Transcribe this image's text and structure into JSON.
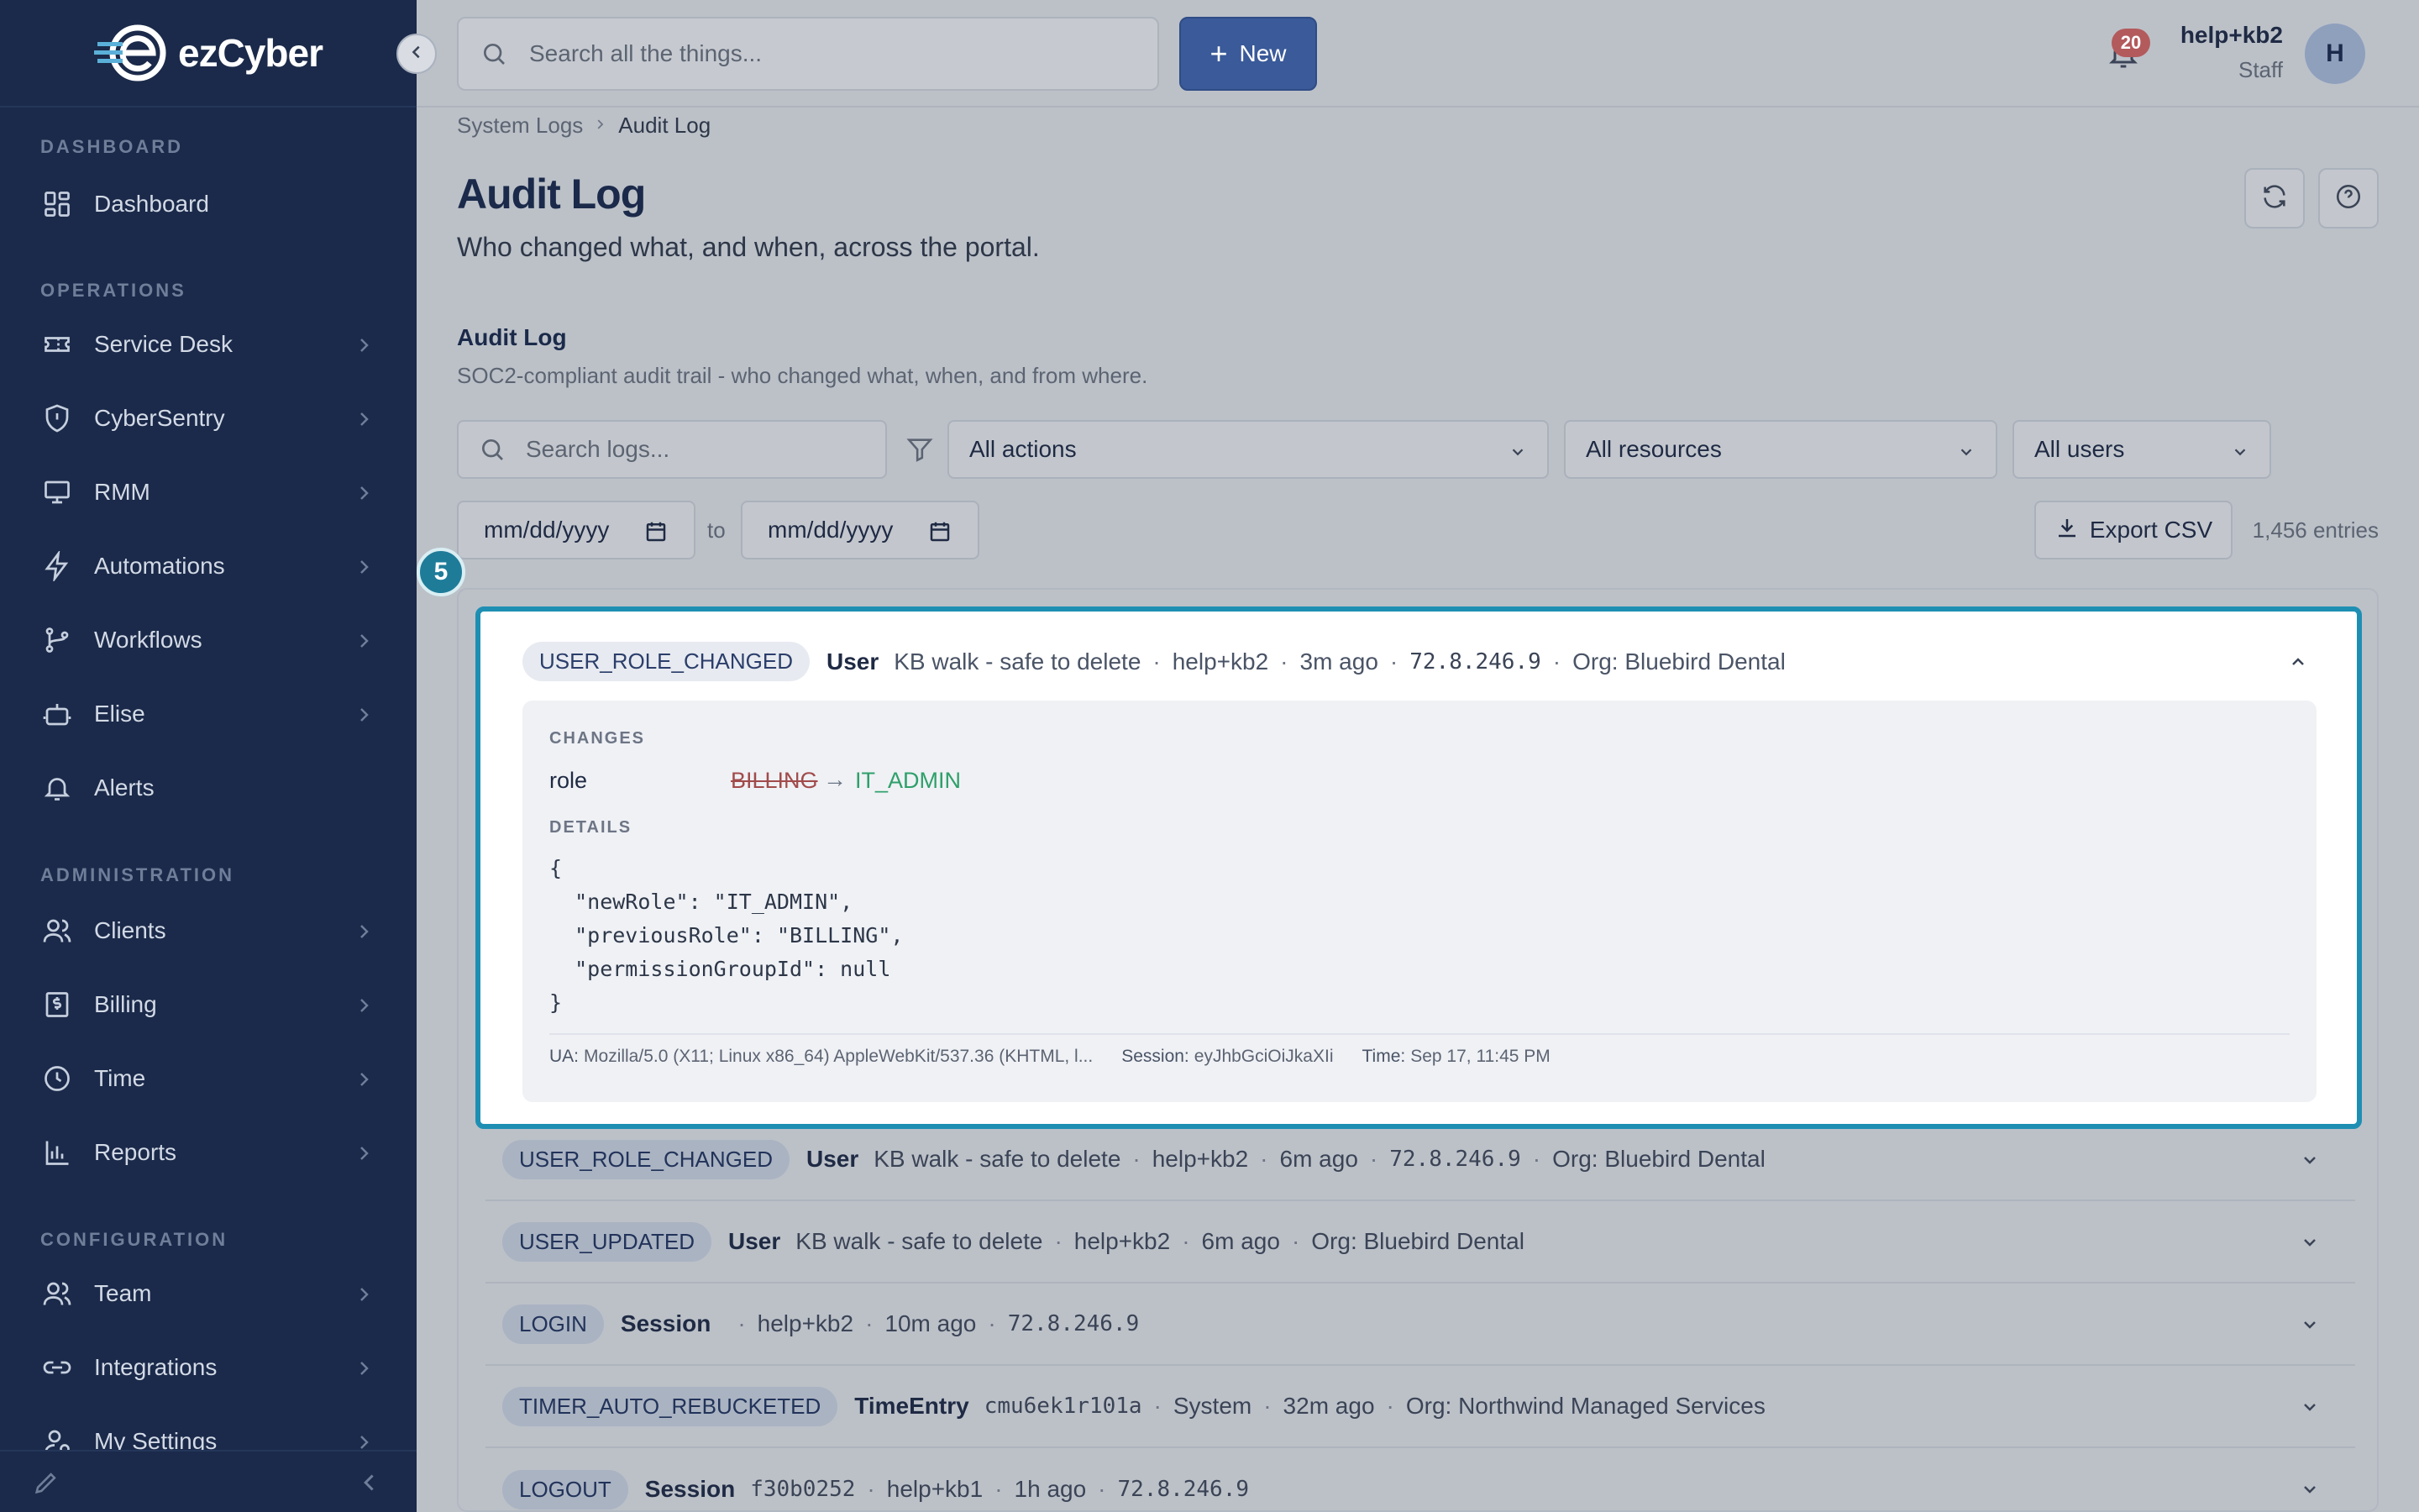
{
  "app": {
    "name": "ezCyber"
  },
  "sidebar": {
    "sections": [
      {
        "title": "DASHBOARD"
      },
      {
        "title": "OPERATIONS"
      },
      {
        "title": "ADMINISTRATION"
      },
      {
        "title": "CONFIGURATION"
      }
    ],
    "items": [
      {
        "label": "Dashboard",
        "icon": "grid-icon"
      },
      {
        "label": "Service Desk",
        "icon": "ticket-icon"
      },
      {
        "label": "CyberSentry",
        "icon": "shield-icon"
      },
      {
        "label": "RMM",
        "icon": "monitor-icon"
      },
      {
        "label": "Automations",
        "icon": "bolt-icon"
      },
      {
        "label": "Workflows",
        "icon": "workflow-icon"
      },
      {
        "label": "Elise",
        "icon": "robot-icon"
      },
      {
        "label": "Alerts",
        "icon": "bell-icon"
      },
      {
        "label": "Clients",
        "icon": "users-icon"
      },
      {
        "label": "Billing",
        "icon": "dollar-icon"
      },
      {
        "label": "Time",
        "icon": "clock-icon"
      },
      {
        "label": "Reports",
        "icon": "bar-chart-icon"
      },
      {
        "label": "Team",
        "icon": "team-icon"
      },
      {
        "label": "Integrations",
        "icon": "link-icon"
      },
      {
        "label": "My Settings",
        "icon": "user-settings-icon"
      }
    ]
  },
  "topbar": {
    "search_placeholder": "Search all the things...",
    "new_label": "New",
    "notification_count": "20",
    "user_name": "help+kb2",
    "user_role": "Staff",
    "avatar_initial": "H"
  },
  "breadcrumb": {
    "parent": "System Logs",
    "current": "Audit Log"
  },
  "page": {
    "title": "Audit Log",
    "subtitle": "Who changed what, and when, across the portal."
  },
  "section": {
    "title": "Audit Log",
    "subtitle": "SOC2-compliant audit trail - who changed what, when, and from where."
  },
  "filters": {
    "search_placeholder": "Search logs...",
    "actions": "All actions",
    "resources": "All resources",
    "users": "All users",
    "date_from": "mm/dd/yyyy",
    "date_to": "mm/dd/yyyy",
    "to_label": "to",
    "export_label": "Export CSV",
    "entries": "1,456 entries"
  },
  "step_badge": "5",
  "expanded_entry": {
    "action": "USER_ROLE_CHANGED",
    "resource": "User",
    "target": "KB walk - safe to delete",
    "user": "help+kb2",
    "time": "3m ago",
    "ip": "72.8.246.9",
    "org": "Org: Bluebird Dental",
    "changes_label": "CHANGES",
    "change_key": "role",
    "change_old": "BILLING",
    "change_new": "IT_ADMIN",
    "details_label": "DETAILS",
    "details_json": "{\n  \"newRole\": \"IT_ADMIN\",\n  \"previousRole\": \"BILLING\",\n  \"permissionGroupId\": null\n}",
    "ua_label": "UA:",
    "ua_value": "Mozilla/5.0 (X11; Linux x86_64) AppleWebKit/537.36 (KHTML, l...",
    "session_label": "Session:",
    "session_value": "eyJhbGciOiJkaXIi",
    "time_label": "Time:",
    "time_value": "Sep 17, 11:45 PM"
  },
  "rows": [
    {
      "action": "USER_ROLE_CHANGED",
      "resource": "User",
      "target": "KB walk - safe to delete",
      "user": "help+kb2",
      "time": "6m ago",
      "ip": "72.8.246.9",
      "org": "Org: Bluebird Dental"
    },
    {
      "action": "USER_UPDATED",
      "resource": "User",
      "target": "KB walk - safe to delete",
      "user": "help+kb2",
      "time": "6m ago",
      "org": "Org: Bluebird Dental"
    },
    {
      "action": "LOGIN",
      "resource": "Session",
      "user": "help+kb2",
      "time": "10m ago",
      "ip": "72.8.246.9"
    },
    {
      "action": "TIMER_AUTO_REBUCKETED",
      "resource": "TimeEntry",
      "id": "cmu6ek1r101a",
      "user": "System",
      "time": "32m ago",
      "org": "Org: Northwind Managed Services"
    },
    {
      "action": "LOGOUT",
      "resource": "Session",
      "id": "f30b0252",
      "user": "help+kb1",
      "time": "1h ago",
      "ip": "72.8.246.9"
    }
  ]
}
